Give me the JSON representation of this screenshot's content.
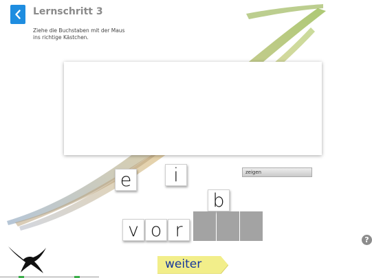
{
  "header": {
    "title": "Lernschritt 3",
    "instruction_line1": "Ziehe die Buchstaben mit der Maus",
    "instruction_line2": "ins richtige Kästchen."
  },
  "tiles": {
    "t1": "e",
    "t2": "i",
    "t3": "b",
    "t4": "v",
    "t5": "o",
    "t6": "r"
  },
  "buttons": {
    "show": "zeigen",
    "next": "weiter",
    "help": "?"
  },
  "icons": {
    "back": "chevron-left-icon",
    "help": "question-mark-icon",
    "logo": "bird-logo-icon"
  },
  "colors": {
    "accent": "#1e8de0",
    "next_button": "#f2ee8a",
    "next_text": "#16379b",
    "slot": "#a3a3a3"
  }
}
